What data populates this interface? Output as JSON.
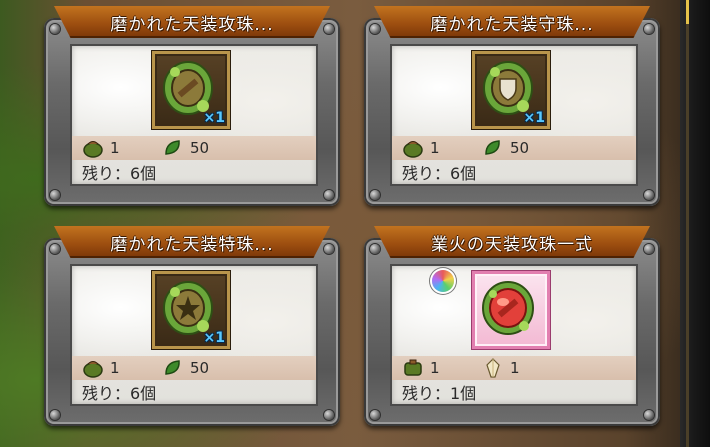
{
  "items": [
    {
      "title": "磨かれた天装攻珠...",
      "quantity": "×1",
      "orb_symbol": "sword",
      "rarity": "normal",
      "cost1_value": "1",
      "cost1_icon": "green-pouch-icon",
      "cost2_value": "50",
      "cost2_icon": "green-leaf-icon",
      "remaining": "残り：6個"
    },
    {
      "title": "磨かれた天装守珠...",
      "quantity": "×1",
      "orb_symbol": "shield",
      "rarity": "normal",
      "cost1_value": "1",
      "cost1_icon": "green-pouch-icon",
      "cost2_value": "50",
      "cost2_icon": "green-leaf-icon",
      "remaining": "残り：6個"
    },
    {
      "title": "磨かれた天装特珠...",
      "quantity": "×1",
      "orb_symbol": "star",
      "rarity": "normal",
      "cost1_value": "1",
      "cost1_icon": "green-pouch-icon",
      "cost2_value": "50",
      "cost2_icon": "green-leaf-icon",
      "remaining": "残り：6個"
    },
    {
      "title": "業火の天装攻珠一式",
      "quantity": "",
      "orb_symbol": "sword-red",
      "rarity": "rare",
      "cost1_value": "1",
      "cost1_icon": "green-bag-icon",
      "cost2_value": "1",
      "cost2_icon": "crystal-icon",
      "remaining": "残り：1個"
    }
  ],
  "colors": {
    "title_bar": "#9e4f10",
    "qty_text": "#58c8ff",
    "cost_row": "#d8bfac",
    "rare_frame": "#e27fb0"
  }
}
